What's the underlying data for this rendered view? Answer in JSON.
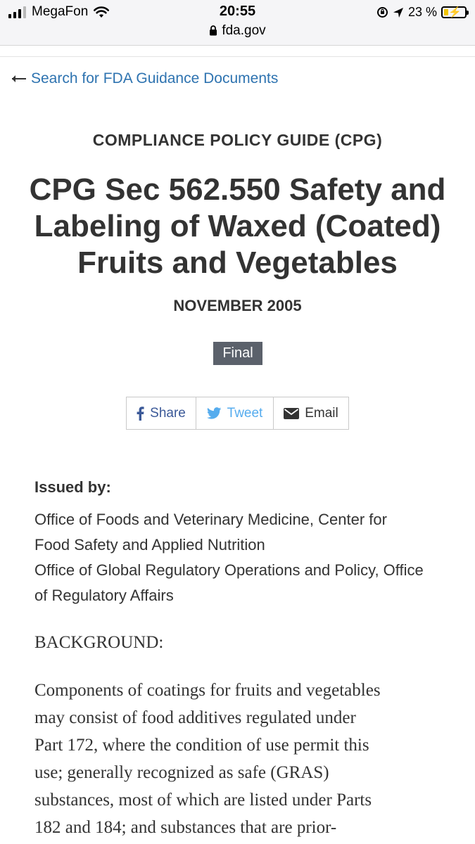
{
  "status_bar": {
    "carrier": "MegaFon",
    "time": "20:55",
    "url": "fda.gov",
    "battery": "23 %",
    "battery_level": 0.23
  },
  "nav": {
    "back_link": "Search for FDA Guidance Documents"
  },
  "document": {
    "eyebrow": "COMPLIANCE POLICY GUIDE (CPG)",
    "title_lines": [
      "CPG Sec 562.550 Safety and",
      "Labeling of Waxed (Coated)",
      "Fruits and Vegetables"
    ],
    "date": "NOVEMBER 2005",
    "status_badge": "Final"
  },
  "share": {
    "facebook": "Share",
    "twitter": "Tweet",
    "email": "Email"
  },
  "issued_by": {
    "label": "Issued by:",
    "lines": [
      "Office of Foods and Veterinary Medicine, Center for",
      "Food Safety and Applied Nutrition",
      "Office of Global Regulatory Operations and Policy, Office",
      "of Regulatory Affairs"
    ]
  },
  "background": {
    "heading": "BACKGROUND:",
    "lines": [
      "Components of coatings for fruits and vegetables",
      "may consist of food additives regulated under",
      "Part 172, where the condition of use permit this",
      "use; generally recognized as safe (GRAS)",
      "substances, most of which are listed under Parts",
      "182 and 184; and substances that are prior-"
    ]
  },
  "colors": {
    "link": "#2e73b0",
    "badge": "#5b616b",
    "facebook": "#3b5998",
    "twitter": "#55acee",
    "text": "#333333"
  }
}
